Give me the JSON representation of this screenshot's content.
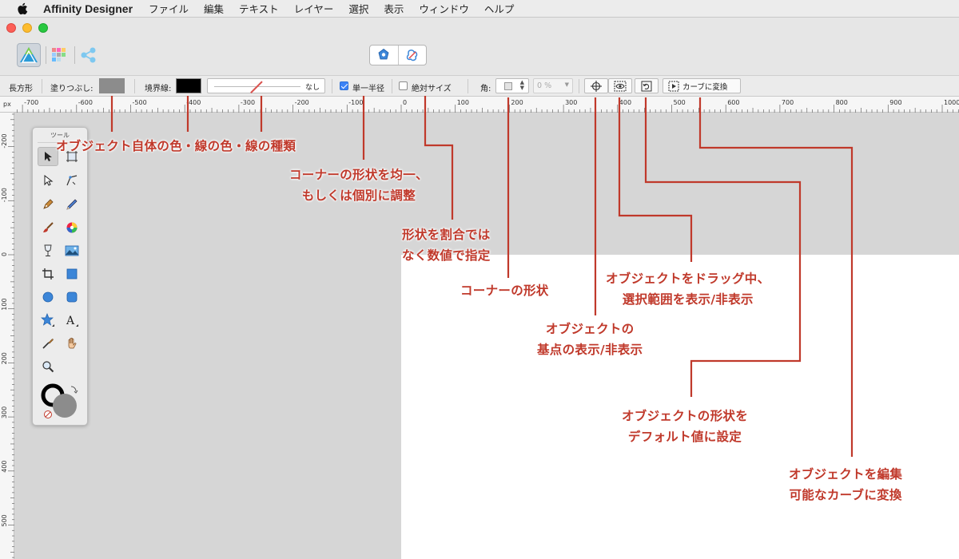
{
  "menubar": {
    "app_name": "Affinity Designer",
    "items": [
      "ファイル",
      "編集",
      "テキスト",
      "レイヤー",
      "選択",
      "表示",
      "ウィンドウ",
      "ヘルプ"
    ]
  },
  "context_toolbar": {
    "shape_name": "長方形",
    "fill_label": "塗りつぶし:",
    "fill_color": "#8c8c8c",
    "stroke_label": "境界線:",
    "stroke_color": "#000000",
    "stroke_style_value": "なし",
    "single_radius_label": "単一半径",
    "single_radius_checked": true,
    "absolute_size_label": "絶対サイズ",
    "absolute_size_checked": false,
    "corner_label": "角:",
    "corner_percent": "0 %",
    "convert_to_curves_label": "カーブに変換"
  },
  "ruler": {
    "unit": "px",
    "top_ticks": [
      "-700",
      "-600",
      "-500",
      "-400",
      "-300",
      "-200",
      "-100",
      "0",
      "100",
      "200",
      "300",
      "400",
      "500",
      "600",
      "700",
      "800",
      "900",
      "1000"
    ],
    "left_ticks": [
      "-200",
      "-100",
      "0",
      "100",
      "200",
      "300",
      "400",
      "500"
    ]
  },
  "tools_panel": {
    "title": "ツール"
  },
  "annotations": {
    "fill_stroke": "オブジェクト自体の色・線の色・線の種類",
    "single_radius": [
      "コーナーの形状を均一、",
      "もしくは個別に調整"
    ],
    "absolute_size": [
      "形状を割合では",
      "なく数値で指定"
    ],
    "corner_shape": "コーナーの形状",
    "drag_selection": [
      "オブジェクトをドラッグ中、",
      "選択範囲を表示/非表示"
    ],
    "origin": [
      "オブジェクトの",
      "基点の表示/非表示"
    ],
    "reset_shape": [
      "オブジェクトの形状を",
      "デフォルト値に設定"
    ],
    "convert_curves": [
      "オブジェクトを編集",
      "可能なカーブに変換"
    ]
  },
  "colors": {
    "annotation": "#c0392b",
    "canvas": "#d6d6d6",
    "artboard": "#ffffff"
  }
}
